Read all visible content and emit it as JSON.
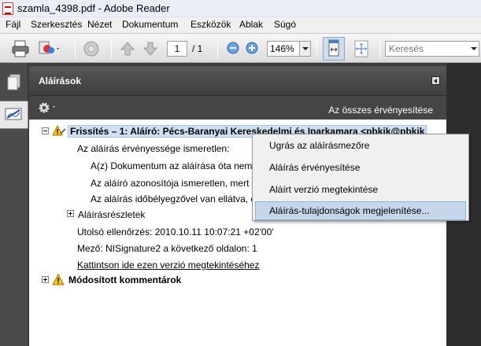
{
  "window": {
    "title": "szamla_4398.pdf - Adobe Reader"
  },
  "menu": [
    "Fájl",
    "Szerkesztés",
    "Nézet",
    "Dokumentum",
    "Eszközök",
    "Ablak",
    "Súgó"
  ],
  "toolbar": {
    "page_current": "1",
    "page_total": "/ 1",
    "zoom": "146%",
    "search_placeholder": "Keresés"
  },
  "panel": {
    "title": "Aláírások",
    "validate_all": "Az összes érvényesítése",
    "signature": {
      "title": "Frissítés – 1: Aláíró: Pécs-Baranyai Kereskedelmi és Iparkamara <pbkik@pbkik.hu>",
      "validity_unknown": "Az aláírás érvényessége ismeretlen:",
      "doc_changed": "A(z) Dokumentum az aláírása óta nem m",
      "identity_unknown": "Az aláíró azonosítója ismeretlen, mert n",
      "timestamp": "Az aláírás időbélyegzővel van ellátva, de",
      "details": "Aláírásrészletek",
      "last_checked": "Utolsó ellenőrzés: 2010.10.11 10:07:21 +02'00'",
      "field": "Mező: NISignature2 a következő oldalon: 1",
      "view_version_link": "Kattintson ide ezen verzió megtekintéséhez"
    },
    "modified_comments": "Módosított kommentárok"
  },
  "context_menu": {
    "items": [
      "Ugrás az aláírásmezőre",
      "Aláírás érvényesítése",
      "Aláírt verzió megtekintése",
      "Aláírás-tulajdonságok megjelenítése..."
    ]
  },
  "colors": {
    "panel_dark": "#3c3c3c",
    "selection": "#cfe0f4",
    "menu_highlight": "#c6d6eb"
  }
}
